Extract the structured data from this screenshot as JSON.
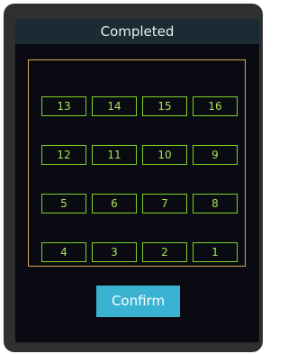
{
  "title": "Completed",
  "grid": {
    "rows": [
      [
        "13",
        "14",
        "15",
        "16"
      ],
      [
        "12",
        "11",
        "10",
        "9"
      ],
      [
        "5",
        "6",
        "7",
        "8"
      ],
      [
        "4",
        "3",
        "2",
        "1"
      ]
    ]
  },
  "confirm_label": "Confirm",
  "colors": {
    "screen_bg": "#0a0b12",
    "title_bar_bg": "#1b2b33",
    "panel_border": "#d9a85a",
    "slot_border": "#7fcf2a",
    "slot_text": "#a7e35a",
    "confirm_bg": "#3ab3d3"
  }
}
